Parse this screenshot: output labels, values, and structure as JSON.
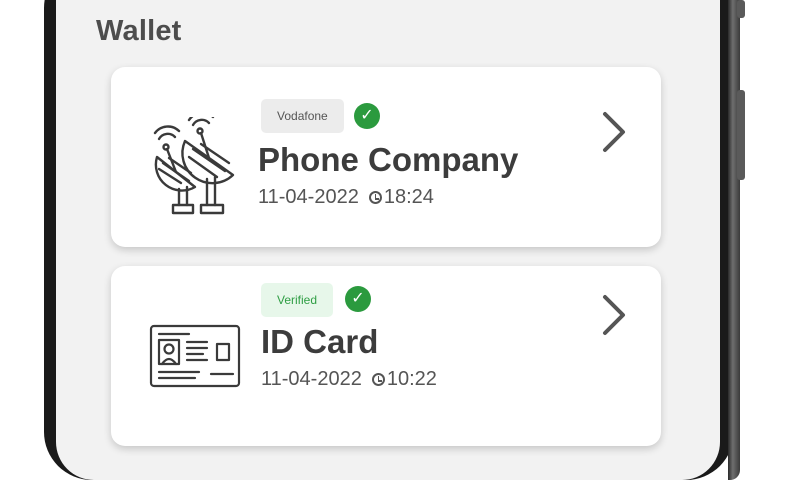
{
  "wallet": {
    "title": "Wallet",
    "cards": [
      {
        "badge": "Vodafone",
        "title": "Phone Company",
        "date": "11-04-2022",
        "time": "18:24",
        "icon": "satellite-dish-icon"
      },
      {
        "badge": "Verified",
        "title": "ID Card",
        "date": "11-04-2022",
        "time": "10:22",
        "icon": "id-card-icon"
      }
    ]
  },
  "colors": {
    "verified_green": "#2b9a3e",
    "screen_background": "#f2f2f2",
    "text_dark": "#3c3c3c"
  }
}
